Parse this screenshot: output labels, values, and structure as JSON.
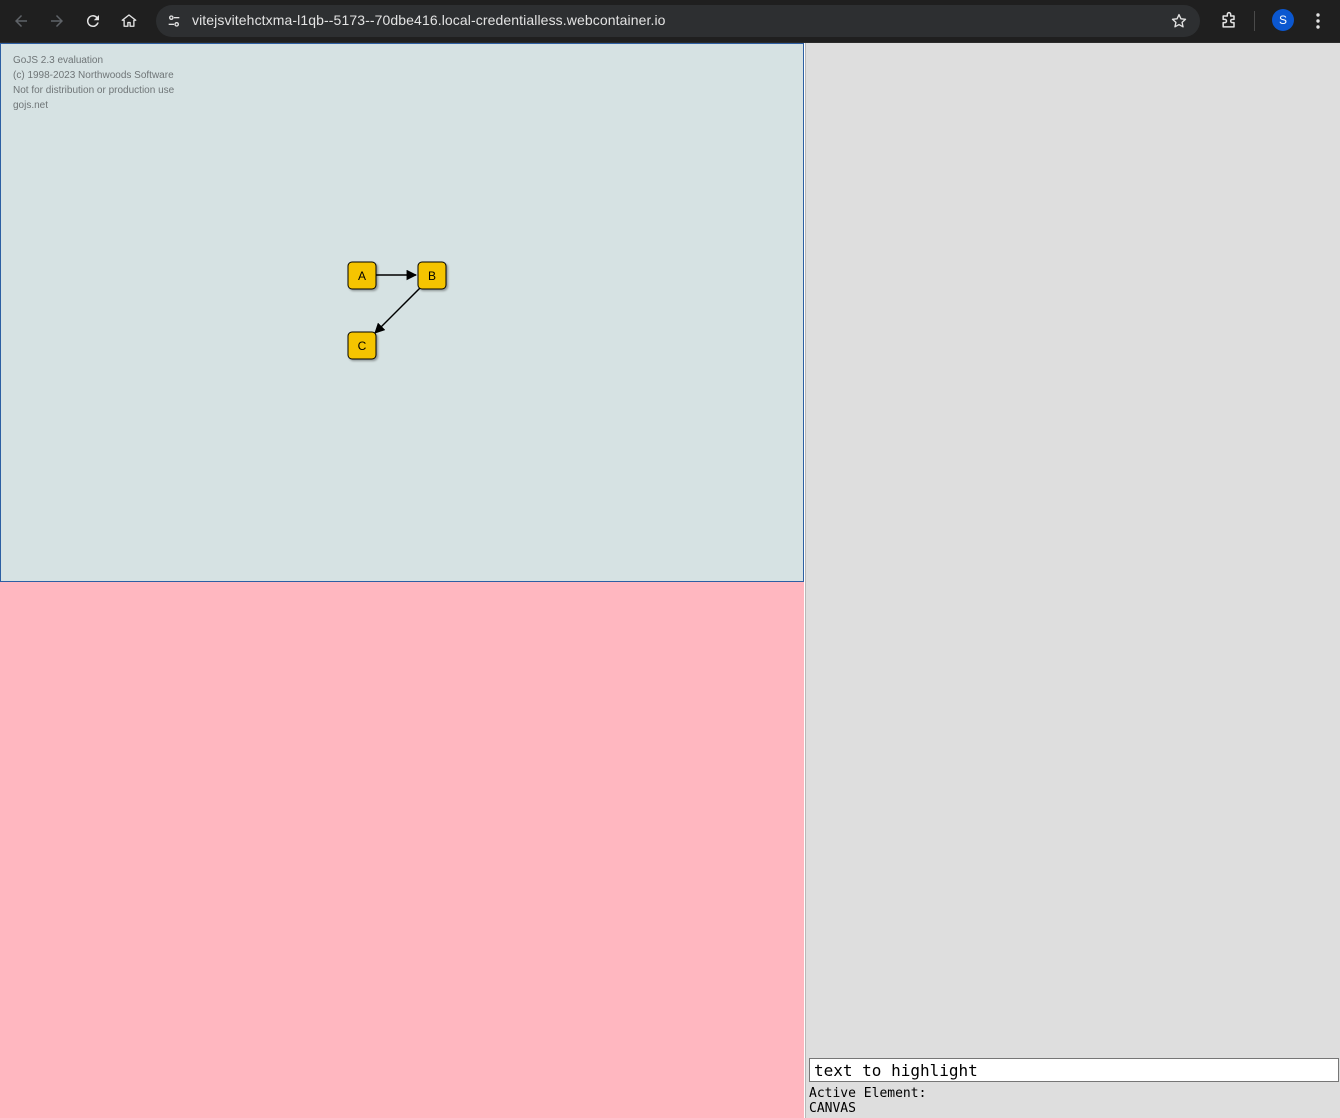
{
  "browser": {
    "url": "vitejsvitehctxma-l1qb--5173--70dbe416.local-credentialless.webcontainer.io",
    "profile_initial": "S",
    "icons": {
      "back": "arrow-left-icon",
      "forward": "arrow-right-icon",
      "reload": "reload-icon",
      "home": "home-icon",
      "site_settings": "tune-icon",
      "bookmark": "star-icon",
      "extensions": "puzzle-icon",
      "menu": "kebab-menu-icon"
    }
  },
  "diagram": {
    "watermark": [
      "GoJS 2.3 evaluation",
      "(c) 1998-2023 Northwoods Software",
      "Not for distribution or production use",
      "gojs.net"
    ],
    "nodes": [
      {
        "key": "A",
        "color": "#f5c400"
      },
      {
        "key": "B",
        "color": "#f5c400"
      },
      {
        "key": "C",
        "color": "#f5c400"
      }
    ],
    "links": [
      {
        "from": "A",
        "to": "B"
      },
      {
        "from": "B",
        "to": "C"
      }
    ],
    "background": "#d6e2e3"
  },
  "lower_panel": {
    "color": "#ffb7c0"
  },
  "sidebar": {
    "highlight_input_value": "text to highlight",
    "active_element_label": "Active Element:",
    "active_element_value": "CANVAS"
  }
}
